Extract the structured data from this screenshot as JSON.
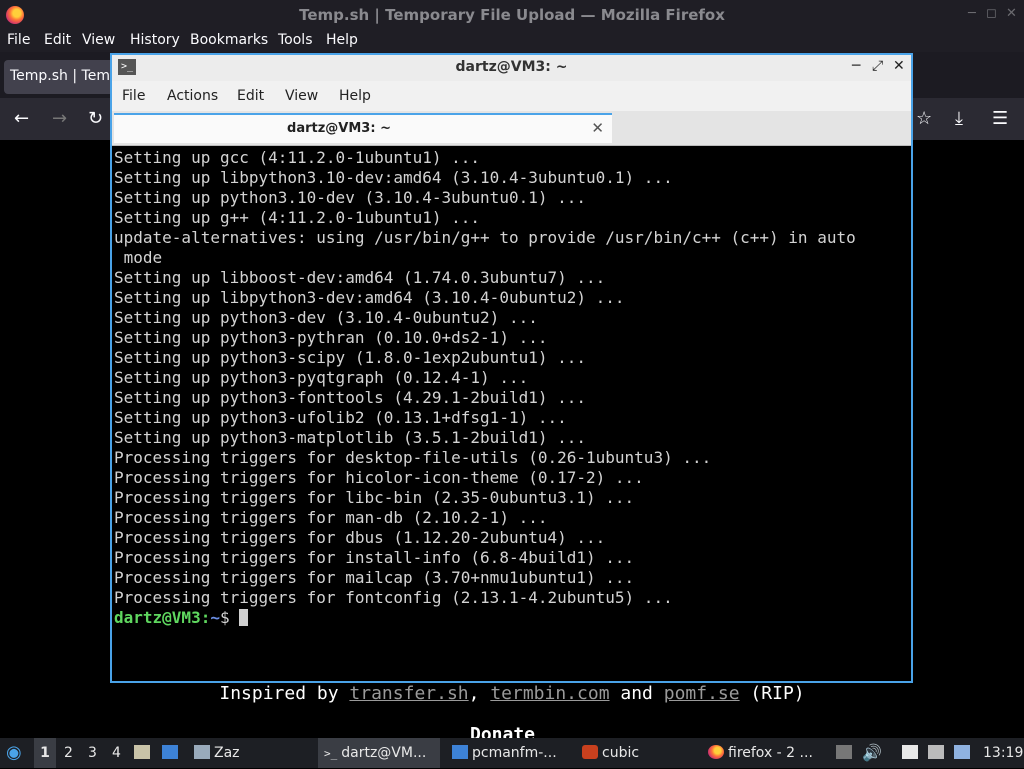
{
  "firefox": {
    "window_title": "Temp.sh | Temporary File Upload — Mozilla Firefox",
    "menu": [
      "File",
      "Edit",
      "View",
      "History",
      "Bookmarks",
      "Tools",
      "Help"
    ],
    "tab_label": "Temp.sh | Temp",
    "page": {
      "tagline_pre": "Inspired by ",
      "link1": "transfer.sh",
      "sep1": ", ",
      "link2": "termbin.com",
      "sep2": " and ",
      "link3": "pomf.se",
      "tagline_post": " (RIP)",
      "cut_heading": "Donate"
    }
  },
  "terminal": {
    "window_title": "dartz@VM3: ~",
    "menu": [
      "File",
      "Actions",
      "Edit",
      "View",
      "Help"
    ],
    "tab_label": "dartz@VM3: ~",
    "lines": [
      "Setting up gcc (4:11.2.0-1ubuntu1) ...",
      "Setting up libpython3.10-dev:amd64 (3.10.4-3ubuntu0.1) ...",
      "Setting up python3.10-dev (3.10.4-3ubuntu0.1) ...",
      "Setting up g++ (4:11.2.0-1ubuntu1) ...",
      "update-alternatives: using /usr/bin/g++ to provide /usr/bin/c++ (c++) in auto",
      " mode",
      "Setting up libboost-dev:amd64 (1.74.0.3ubuntu7) ...",
      "Setting up libpython3-dev:amd64 (3.10.4-0ubuntu2) ...",
      "Setting up python3-dev (3.10.4-0ubuntu2) ...",
      "Setting up python3-pythran (0.10.0+ds2-1) ...",
      "Setting up python3-scipy (1.8.0-1exp2ubuntu1) ...",
      "Setting up python3-pyqtgraph (0.12.4-1) ...",
      "Setting up python3-fonttools (4.29.1-2build1) ...",
      "Setting up python3-ufolib2 (0.13.1+dfsg1-1) ...",
      "Setting up python3-matplotlib (3.5.1-2build1) ...",
      "Processing triggers for desktop-file-utils (0.26-1ubuntu3) ...",
      "Processing triggers for hicolor-icon-theme (0.17-2) ...",
      "Processing triggers for libc-bin (2.35-0ubuntu3.1) ...",
      "Processing triggers for man-db (2.10.2-1) ...",
      "Processing triggers for dbus (1.12.20-2ubuntu4) ...",
      "Processing triggers for install-info (6.8-4build1) ...",
      "Processing triggers for mailcap (3.70+nmu1ubuntu1) ...",
      "Processing triggers for fontconfig (2.13.1-4.2ubuntu5) ..."
    ],
    "prompt_user": "dartz@VM3",
    "prompt_sep": ":",
    "prompt_dir": "~",
    "prompt_sym": "$ "
  },
  "taskbar": {
    "workspaces": [
      "1",
      "2",
      "3",
      "4"
    ],
    "launcher_label": "Zaz",
    "tasks": [
      "dartz@VM...",
      "pcmanfm-...",
      "cubic",
      "firefox - 2 ..."
    ],
    "clock": "13:19"
  },
  "colors": {
    "terminal_border": "#4aa3e8",
    "prompt_user": "#5fd75f",
    "prompt_dir": "#6b8fe6"
  }
}
